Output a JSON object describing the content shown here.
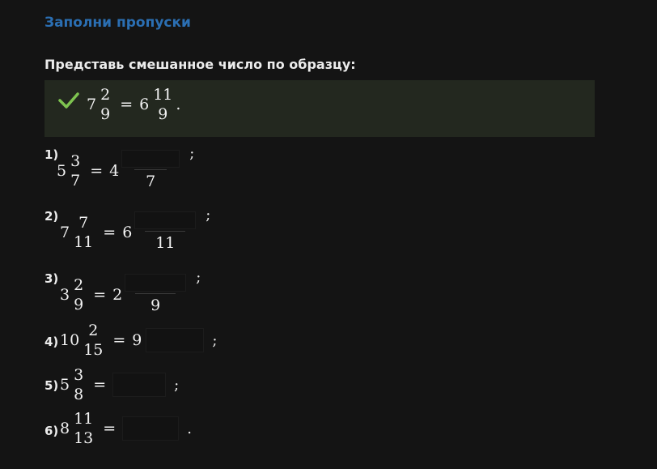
{
  "title": "Заполни пропуски",
  "instruction": "Представь смешанное число по образцу:",
  "example": {
    "whole": "7",
    "num": "2",
    "den": "9",
    "op": "=",
    "r_whole": "6",
    "r_num": "11",
    "r_den": "9",
    "end": "."
  },
  "problems": [
    {
      "label": "1)",
      "whole": "5",
      "num": "3",
      "den": "7",
      "op": "=",
      "r_whole": "4",
      "r_den": "7",
      "end": ";"
    },
    {
      "label": "2)",
      "whole": "7",
      "num": "7",
      "den": "11",
      "op": "=",
      "r_whole": "6",
      "r_den": "11",
      "end": ";"
    },
    {
      "label": "3)",
      "whole": "3",
      "num": "2",
      "den": "9",
      "op": "=",
      "r_whole": "2",
      "r_den": "9",
      "end": ";"
    },
    {
      "label": "4)",
      "whole": "10",
      "num": "2",
      "den": "15",
      "op": "=",
      "r_whole": "9",
      "end": ";"
    },
    {
      "label": "5)",
      "whole": "5",
      "num": "3",
      "den": "8",
      "op": "=",
      "end": ";"
    },
    {
      "label": "6)",
      "whole": "8",
      "num": "11",
      "den": "13",
      "op": "=",
      "end": "."
    }
  ],
  "colors": {
    "title": "#2b6fb3",
    "check": "#7ec450",
    "example_bg": "#23281f"
  },
  "icons": {
    "check": "check-icon"
  }
}
